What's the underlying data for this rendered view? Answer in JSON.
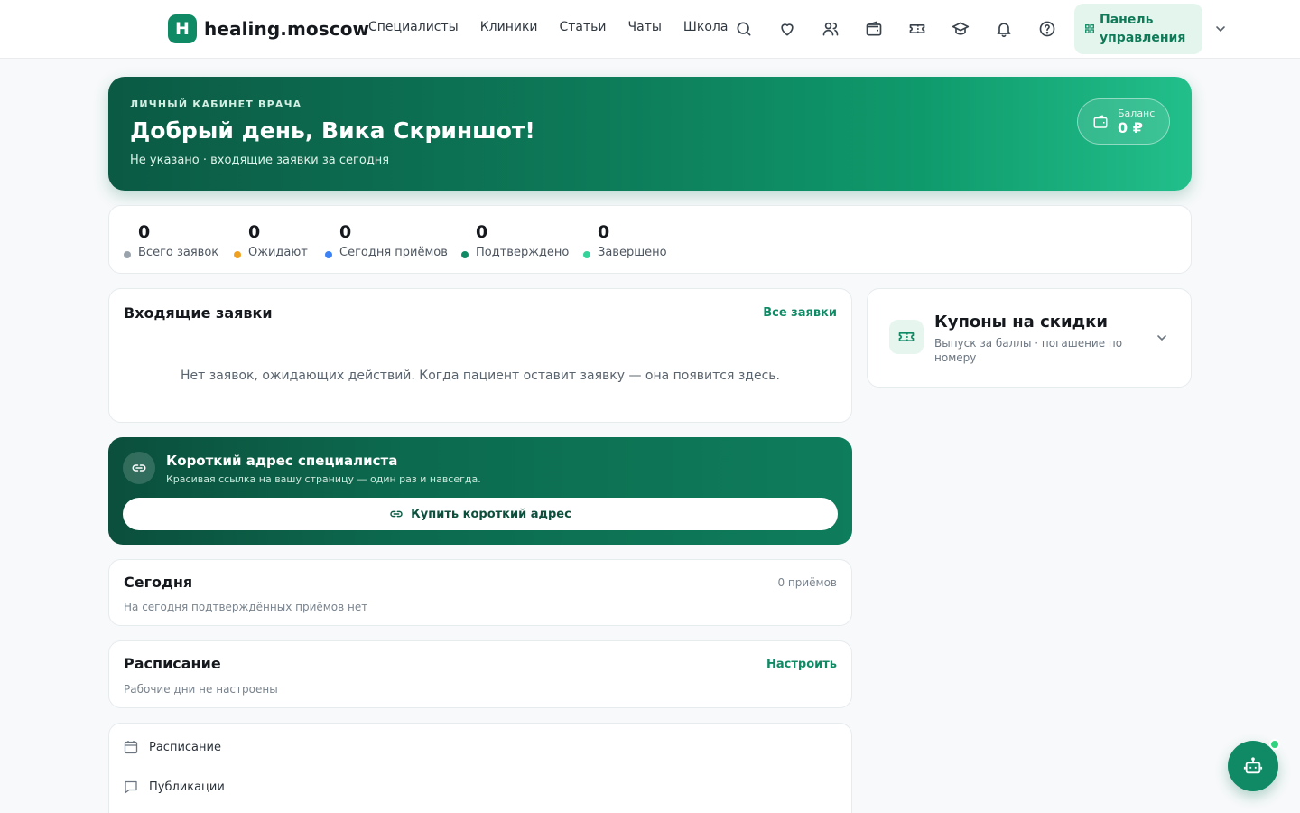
{
  "header": {
    "logo_letter": "H",
    "logo_text": "healing.moscow",
    "nav": [
      "Специалисты",
      "Клиники",
      "Статьи",
      "Чаты",
      "Школа"
    ],
    "icons": [
      "search-icon",
      "heart-icon",
      "users-icon",
      "wallet-icon",
      "ticket-icon",
      "graduation-cap-icon",
      "bell-icon",
      "help-circle-icon"
    ],
    "panel_button": "Панель управления"
  },
  "banner": {
    "eyebrow": "ЛИЧНЫЙ КАБИНЕТ ВРАЧА",
    "greeting": "Добрый день, Вика Скриншот!",
    "subtitle": "Не указано · входящие заявки за сегодня",
    "balance_label": "Баланс",
    "balance_value": "0 ₽"
  },
  "stats": [
    {
      "value": "0",
      "label": "Всего заявок",
      "color": "#9aa3ab"
    },
    {
      "value": "0",
      "label": "Ожидают",
      "color": "#f0a020"
    },
    {
      "value": "0",
      "label": "Сегодня приёмов",
      "color": "#3b82f6"
    },
    {
      "value": "0",
      "label": "Подтверждено",
      "color": "#0f8a64"
    },
    {
      "value": "0",
      "label": "Завершено",
      "color": "#34d399"
    }
  ],
  "requests": {
    "title": "Входящие заявки",
    "link": "Все заявки",
    "empty": "Нет заявок, ожидающих действий. Когда пациент оставит заявку — она появится здесь."
  },
  "short_address": {
    "title": "Короткий адрес специалиста",
    "subtitle": "Красивая ссылка на вашу страницу — один раз и навсегда.",
    "button": "Купить короткий адрес"
  },
  "today": {
    "title": "Сегодня",
    "meta": "0 приёмов",
    "desc": "На сегодня подтверждённых приёмов нет"
  },
  "schedule": {
    "title": "Расписание",
    "link": "Настроить",
    "desc": "Рабочие дни не настроены"
  },
  "menu": [
    "Расписание",
    "Публикации"
  ],
  "coupons": {
    "title": "Купоны на скидки",
    "subtitle": "Выпуск за баллы · погашение по номеру"
  },
  "colors": {
    "brand": "#0f8a64",
    "brand_dark": "#0b5a44",
    "brand_light": "#e3f5ec"
  }
}
